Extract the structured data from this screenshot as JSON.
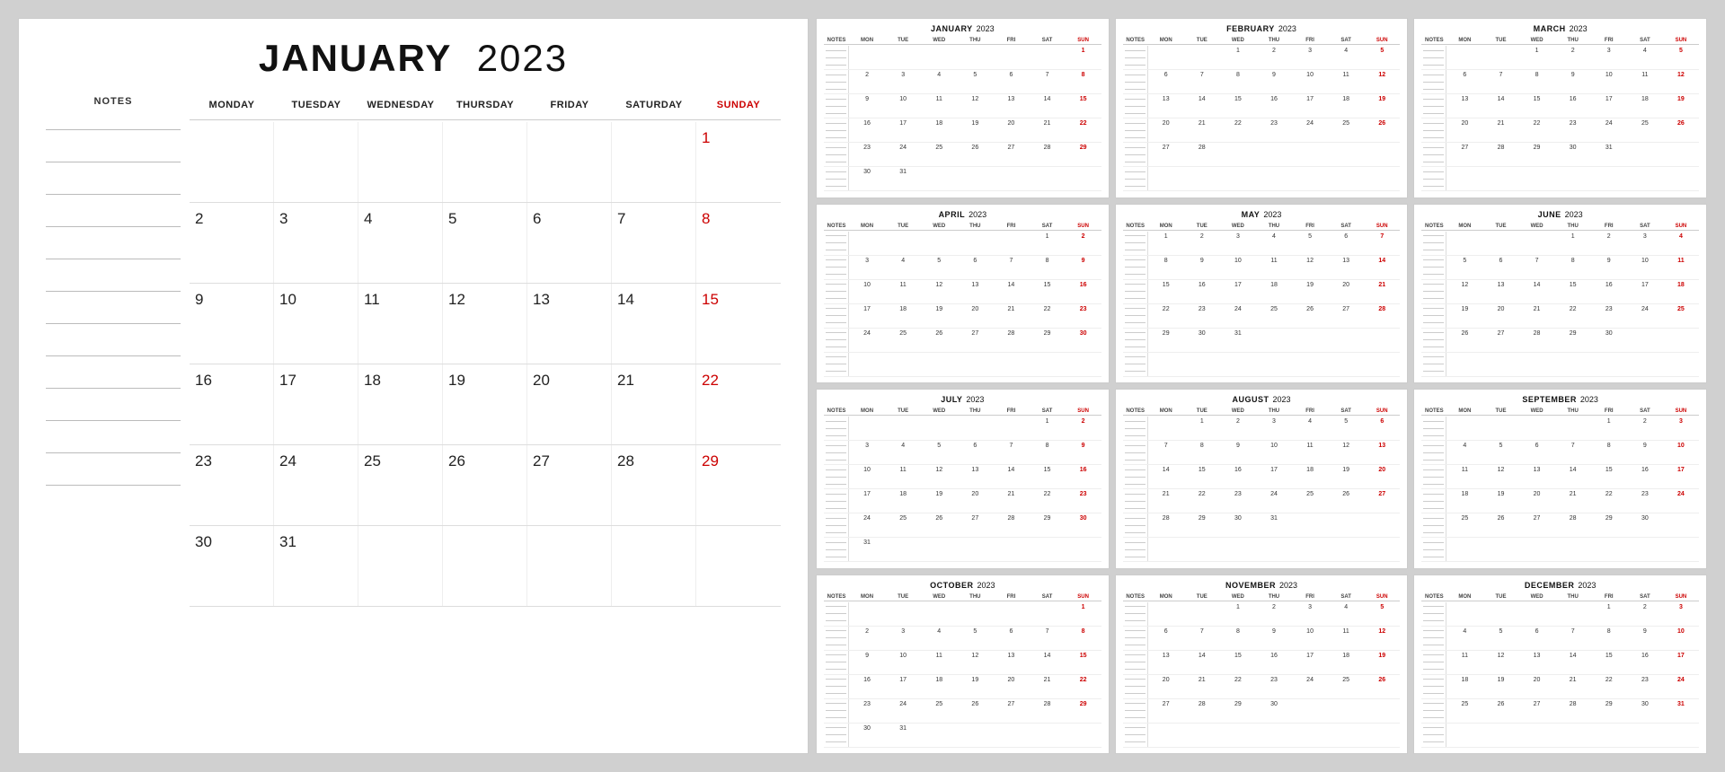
{
  "main": {
    "month": "JANUARY",
    "year": "2023",
    "notes_label": "NOTES",
    "days": [
      "MONDAY",
      "TUESDAY",
      "WEDNESDAY",
      "THURSDAY",
      "FRIDAY",
      "SATURDAY",
      "SUNDAY"
    ],
    "weeks": [
      [
        "",
        "",
        "",
        "",
        "",
        "",
        "1"
      ],
      [
        "2",
        "3",
        "4",
        "5",
        "6",
        "7",
        "8"
      ],
      [
        "9",
        "10",
        "11",
        "12",
        "13",
        "14",
        "15"
      ],
      [
        "16",
        "17",
        "18",
        "19",
        "20",
        "21",
        "22"
      ],
      [
        "23",
        "24",
        "25",
        "26",
        "27",
        "28",
        "29"
      ],
      [
        "30",
        "31",
        "",
        "",
        "",
        "",
        ""
      ]
    ]
  },
  "mini_months": [
    {
      "name": "JANUARY",
      "year": "2023",
      "weeks": [
        [
          "",
          "",
          "",
          "",
          "",
          "",
          "1"
        ],
        [
          "2",
          "3",
          "4",
          "5",
          "6",
          "7",
          "8"
        ],
        [
          "9",
          "10",
          "11",
          "12",
          "13",
          "14",
          "15"
        ],
        [
          "16",
          "17",
          "18",
          "19",
          "20",
          "21",
          "22"
        ],
        [
          "23",
          "24",
          "25",
          "26",
          "27",
          "28",
          "29"
        ],
        [
          "30",
          "31",
          "",
          "",
          "",
          "",
          ""
        ]
      ]
    },
    {
      "name": "FEBRUARY",
      "year": "2023",
      "weeks": [
        [
          "",
          "",
          "1",
          "2",
          "3",
          "4",
          "5"
        ],
        [
          "6",
          "7",
          "8",
          "9",
          "10",
          "11",
          "12"
        ],
        [
          "13",
          "14",
          "15",
          "16",
          "17",
          "18",
          "19"
        ],
        [
          "20",
          "21",
          "22",
          "23",
          "24",
          "25",
          "26"
        ],
        [
          "27",
          "28",
          "",
          "",
          "",
          "",
          ""
        ],
        [
          "",
          "",
          "",
          "",
          "",
          "",
          ""
        ]
      ]
    },
    {
      "name": "MARCH",
      "year": "2023",
      "weeks": [
        [
          "",
          "",
          "1",
          "2",
          "3",
          "4",
          "5"
        ],
        [
          "6",
          "7",
          "8",
          "9",
          "10",
          "11",
          "12"
        ],
        [
          "13",
          "14",
          "15",
          "16",
          "17",
          "18",
          "19"
        ],
        [
          "20",
          "21",
          "22",
          "23",
          "24",
          "25",
          "26"
        ],
        [
          "27",
          "28",
          "29",
          "30",
          "31",
          "",
          ""
        ],
        [
          "",
          "",
          "",
          "",
          "",
          "",
          ""
        ]
      ]
    },
    {
      "name": "APRIL",
      "year": "2023",
      "weeks": [
        [
          "",
          "",
          "",
          "",
          "",
          "1",
          "2"
        ],
        [
          "3",
          "4",
          "5",
          "6",
          "7",
          "8",
          "9"
        ],
        [
          "10",
          "11",
          "12",
          "13",
          "14",
          "15",
          "16"
        ],
        [
          "17",
          "18",
          "19",
          "20",
          "21",
          "22",
          "23"
        ],
        [
          "24",
          "25",
          "26",
          "27",
          "28",
          "29",
          "30"
        ],
        [
          "",
          "",
          "",
          "",
          "",
          "",
          ""
        ]
      ]
    },
    {
      "name": "MAY",
      "year": "2023",
      "weeks": [
        [
          "1",
          "2",
          "3",
          "4",
          "5",
          "6",
          "7"
        ],
        [
          "8",
          "9",
          "10",
          "11",
          "12",
          "13",
          "14"
        ],
        [
          "15",
          "16",
          "17",
          "18",
          "19",
          "20",
          "21"
        ],
        [
          "22",
          "23",
          "24",
          "25",
          "26",
          "27",
          "28"
        ],
        [
          "29",
          "30",
          "31",
          "",
          "",
          "",
          ""
        ],
        [
          "",
          "",
          "",
          "",
          "",
          "",
          ""
        ]
      ]
    },
    {
      "name": "JUNE",
      "year": "2023",
      "weeks": [
        [
          "",
          "",
          "",
          "1",
          "2",
          "3",
          "4"
        ],
        [
          "5",
          "6",
          "7",
          "8",
          "9",
          "10",
          "11"
        ],
        [
          "12",
          "13",
          "14",
          "15",
          "16",
          "17",
          "18"
        ],
        [
          "19",
          "20",
          "21",
          "22",
          "23",
          "24",
          "25"
        ],
        [
          "26",
          "27",
          "28",
          "29",
          "30",
          "",
          ""
        ],
        [
          "",
          "",
          "",
          "",
          "",
          "",
          ""
        ]
      ]
    },
    {
      "name": "JULY",
      "year": "2023",
      "weeks": [
        [
          "",
          "",
          "",
          "",
          "",
          "1",
          "2"
        ],
        [
          "3",
          "4",
          "5",
          "6",
          "7",
          "8",
          "9"
        ],
        [
          "10",
          "11",
          "12",
          "13",
          "14",
          "15",
          "16"
        ],
        [
          "17",
          "18",
          "19",
          "20",
          "21",
          "22",
          "23"
        ],
        [
          "24",
          "25",
          "26",
          "27",
          "28",
          "29",
          "30"
        ],
        [
          "31",
          "",
          "",
          "",
          "",
          "",
          ""
        ]
      ]
    },
    {
      "name": "AUGUST",
      "year": "2023",
      "weeks": [
        [
          "",
          "1",
          "2",
          "3",
          "4",
          "5",
          "6"
        ],
        [
          "7",
          "8",
          "9",
          "10",
          "11",
          "12",
          "13"
        ],
        [
          "14",
          "15",
          "16",
          "17",
          "18",
          "19",
          "20"
        ],
        [
          "21",
          "22",
          "23",
          "24",
          "25",
          "26",
          "27"
        ],
        [
          "28",
          "29",
          "30",
          "31",
          "",
          "",
          ""
        ],
        [
          "",
          "",
          "",
          "",
          "",
          "",
          ""
        ]
      ]
    },
    {
      "name": "SEPTEMBER",
      "year": "2023",
      "weeks": [
        [
          "",
          "",
          "",
          "",
          "1",
          "2",
          "3"
        ],
        [
          "4",
          "5",
          "6",
          "7",
          "8",
          "9",
          "10"
        ],
        [
          "11",
          "12",
          "13",
          "14",
          "15",
          "16",
          "17"
        ],
        [
          "18",
          "19",
          "20",
          "21",
          "22",
          "23",
          "24"
        ],
        [
          "25",
          "26",
          "27",
          "28",
          "29",
          "30",
          ""
        ],
        [
          "",
          "",
          "",
          "",
          "",
          "",
          ""
        ]
      ]
    },
    {
      "name": "OCTOBER",
      "year": "2023",
      "weeks": [
        [
          "",
          "",
          "",
          "",
          "",
          "",
          "1"
        ],
        [
          "2",
          "3",
          "4",
          "5",
          "6",
          "7",
          "8"
        ],
        [
          "9",
          "10",
          "11",
          "12",
          "13",
          "14",
          "15"
        ],
        [
          "16",
          "17",
          "18",
          "19",
          "20",
          "21",
          "22"
        ],
        [
          "23",
          "24",
          "25",
          "26",
          "27",
          "28",
          "29"
        ],
        [
          "30",
          "31",
          "",
          "",
          "",
          "",
          ""
        ]
      ]
    },
    {
      "name": "NOVEMBER",
      "year": "2023",
      "weeks": [
        [
          "",
          "",
          "1",
          "2",
          "3",
          "4",
          "5"
        ],
        [
          "6",
          "7",
          "8",
          "9",
          "10",
          "11",
          "12"
        ],
        [
          "13",
          "14",
          "15",
          "16",
          "17",
          "18",
          "19"
        ],
        [
          "20",
          "21",
          "22",
          "23",
          "24",
          "25",
          "26"
        ],
        [
          "27",
          "28",
          "29",
          "30",
          "",
          "",
          ""
        ],
        [
          "",
          "",
          "",
          "",
          "",
          "",
          ""
        ]
      ]
    },
    {
      "name": "DECEMBER",
      "year": "2023",
      "weeks": [
        [
          "",
          "",
          "",
          "",
          "1",
          "2",
          "3"
        ],
        [
          "4",
          "5",
          "6",
          "7",
          "8",
          "9",
          "10"
        ],
        [
          "11",
          "12",
          "13",
          "14",
          "15",
          "16",
          "17"
        ],
        [
          "18",
          "19",
          "20",
          "21",
          "22",
          "23",
          "24"
        ],
        [
          "25",
          "26",
          "27",
          "28",
          "29",
          "30",
          "31"
        ],
        [
          "",
          "",
          "",
          "",
          "",
          "",
          ""
        ]
      ]
    }
  ],
  "sunday_color": "#cc0000",
  "day_headers_mini": [
    "NOTES",
    "MON",
    "TUE",
    "WED",
    "THU",
    "FRI",
    "SAT",
    "SUN"
  ]
}
